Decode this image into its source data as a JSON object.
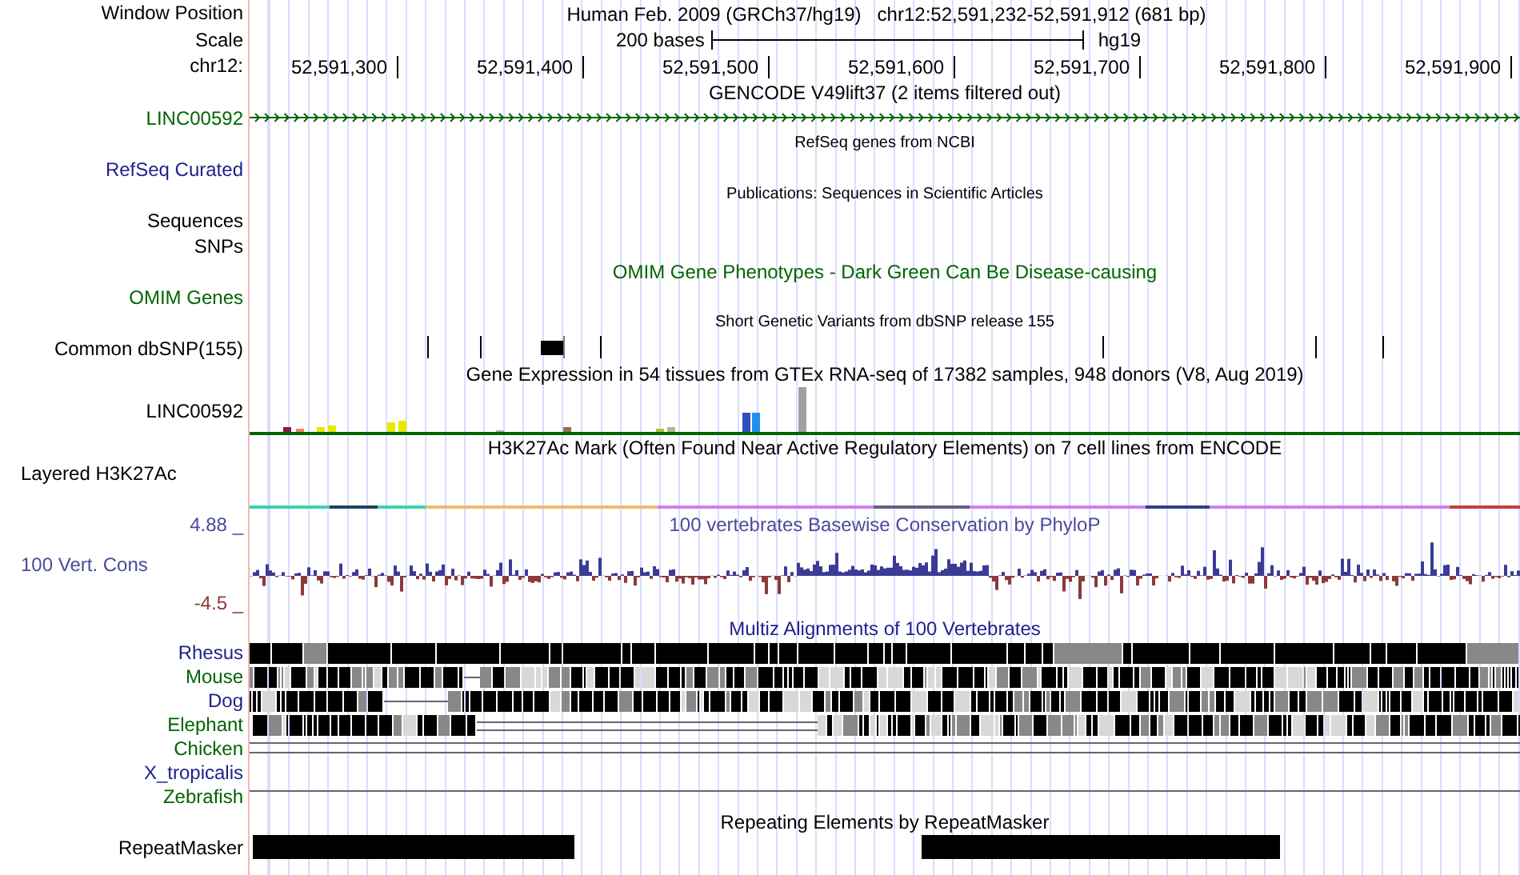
{
  "header": {
    "label": "Window Position",
    "assembly": "Human Feb. 2009 (GRCh37/hg19)",
    "position": "chr12:52,591,232-52,591,912 (681 bp)"
  },
  "scale": {
    "label": "Scale",
    "length": "200 bases",
    "assembly": "hg19"
  },
  "ruler": {
    "label": "chr12:",
    "ticks": [
      "52,591,300",
      "52,591,400",
      "52,591,500",
      "52,591,600",
      "52,591,700",
      "52,591,800",
      "52,591,900"
    ]
  },
  "tracks": [
    {
      "kind": "gene",
      "title": "GENCODE V49lift37 (2 items filtered out)",
      "label": "LINC00592",
      "color": "#006400"
    },
    {
      "kind": "empty",
      "title": "RefSeq genes from NCBI",
      "label": "RefSeq Curated",
      "color": "#1e1e8c"
    },
    {
      "kind": "empty",
      "title": "Publications: Sequences in Scientific Articles",
      "label": "Sequences SNPs",
      "color": "#000000"
    },
    {
      "kind": "phenotype",
      "title": "OMIM Gene Phenotypes - Dark Green Can Be Disease-causing",
      "label": "OMIM Genes",
      "color": "#006400"
    },
    {
      "kind": "variants",
      "title": "Short Genetic Variants from dbSNP release 155",
      "label": "Common dbSNP(155)",
      "color": "#000000"
    },
    {
      "kind": "expression",
      "title": "Gene Expression in 54 tissues from GTEx RNA-seq of 17382 samples, 948 donors (V8, Aug 2019)",
      "label": "LINC00592",
      "color": "#000000"
    },
    {
      "kind": "signal",
      "title": "H3K27Ac Mark (Often Found Near Active Regulatory Elements) on 7 cell lines from ENCODE",
      "label": "Layered H3K27Ac",
      "color": "#000000"
    },
    {
      "kind": "conservation",
      "title": "100 vertebrates Basewise Conservation by PhyloP",
      "label": "100 Vert. Cons",
      "color": "#4a4a9c",
      "max": "4.88 _",
      "min": "-4.5 _"
    },
    {
      "kind": "alignment",
      "title": "Multiz Alignments of 100 Vertebrates",
      "species": [
        {
          "name": "Rhesus",
          "color": "#1e1e8c",
          "kind": "solid"
        },
        {
          "name": "Mouse",
          "color": "#006400",
          "kind": "striped"
        },
        {
          "name": "Dog",
          "color": "#1e1e8c",
          "kind": "striped"
        },
        {
          "name": "Elephant",
          "color": "#006400",
          "kind": "partial"
        },
        {
          "name": "Chicken",
          "color": "#006400",
          "kind": "double_line"
        },
        {
          "name": "X_tropicalis",
          "color": "#1e1e8c",
          "kind": "none"
        },
        {
          "name": "Zebrafish",
          "color": "#006400",
          "kind": "single_line"
        }
      ]
    },
    {
      "kind": "repeats",
      "title": "Repeating Elements by RepeatMasker",
      "label": "RepeatMasker",
      "color": "#000000"
    }
  ]
}
